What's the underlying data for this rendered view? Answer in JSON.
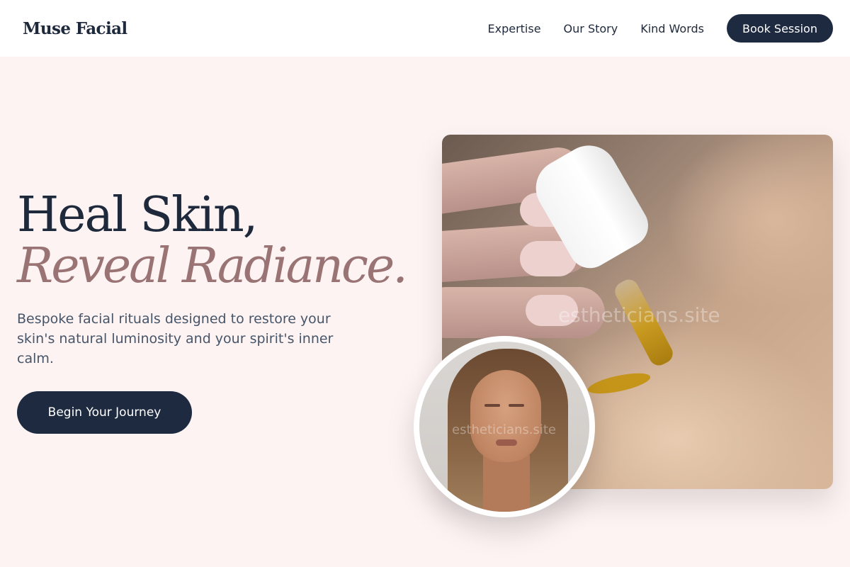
{
  "header": {
    "logo": "Muse Facial",
    "nav": [
      {
        "label": "Expertise"
      },
      {
        "label": "Our Story"
      },
      {
        "label": "Kind Words"
      }
    ],
    "book_label": "Book Session"
  },
  "hero": {
    "headline_line1": "Heal Skin,",
    "headline_line2": "Reveal Radiance.",
    "subtitle": "Bespoke facial rituals designed to restore your skin's natural luminosity and your spirit's inner calm.",
    "cta_label": "Begin Your Journey"
  },
  "images": {
    "main_photo_watermark": "estheticians.site",
    "portrait_watermark": "estheticians.site"
  },
  "colors": {
    "background": "#fdf3f2",
    "navy": "#1e2a40",
    "accent_mauve": "#9a7475",
    "text_muted": "#475569"
  }
}
